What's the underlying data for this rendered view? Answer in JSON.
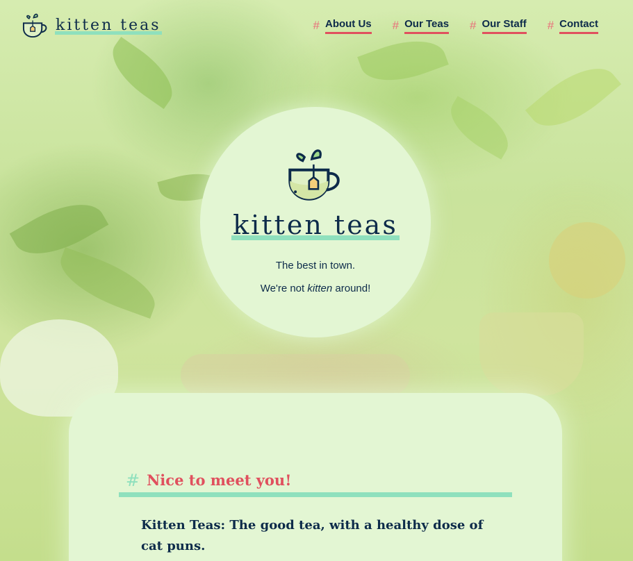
{
  "brand": {
    "name": "kitten teas",
    "logo_icon": "teacup-icon"
  },
  "nav": {
    "hash_symbol": "#",
    "items": [
      {
        "label": "About Us"
      },
      {
        "label": "Our Teas"
      },
      {
        "label": "Our Staff"
      },
      {
        "label": "Contact"
      }
    ]
  },
  "hero": {
    "title": "kitten teas",
    "tagline": "The best in town.",
    "pun_prefix": "We're not ",
    "pun_emphasis": "kitten",
    "pun_suffix": " around!"
  },
  "section": {
    "hash_symbol": "#",
    "title": "Nice to meet you!",
    "body": "Kitten Teas: The good tea, with a healthy dose of cat puns."
  },
  "colors": {
    "navy": "#0d2b4a",
    "accent_red": "#e0505e",
    "accent_mint": "#8fe0bd",
    "panel": "#e3f6d3"
  }
}
